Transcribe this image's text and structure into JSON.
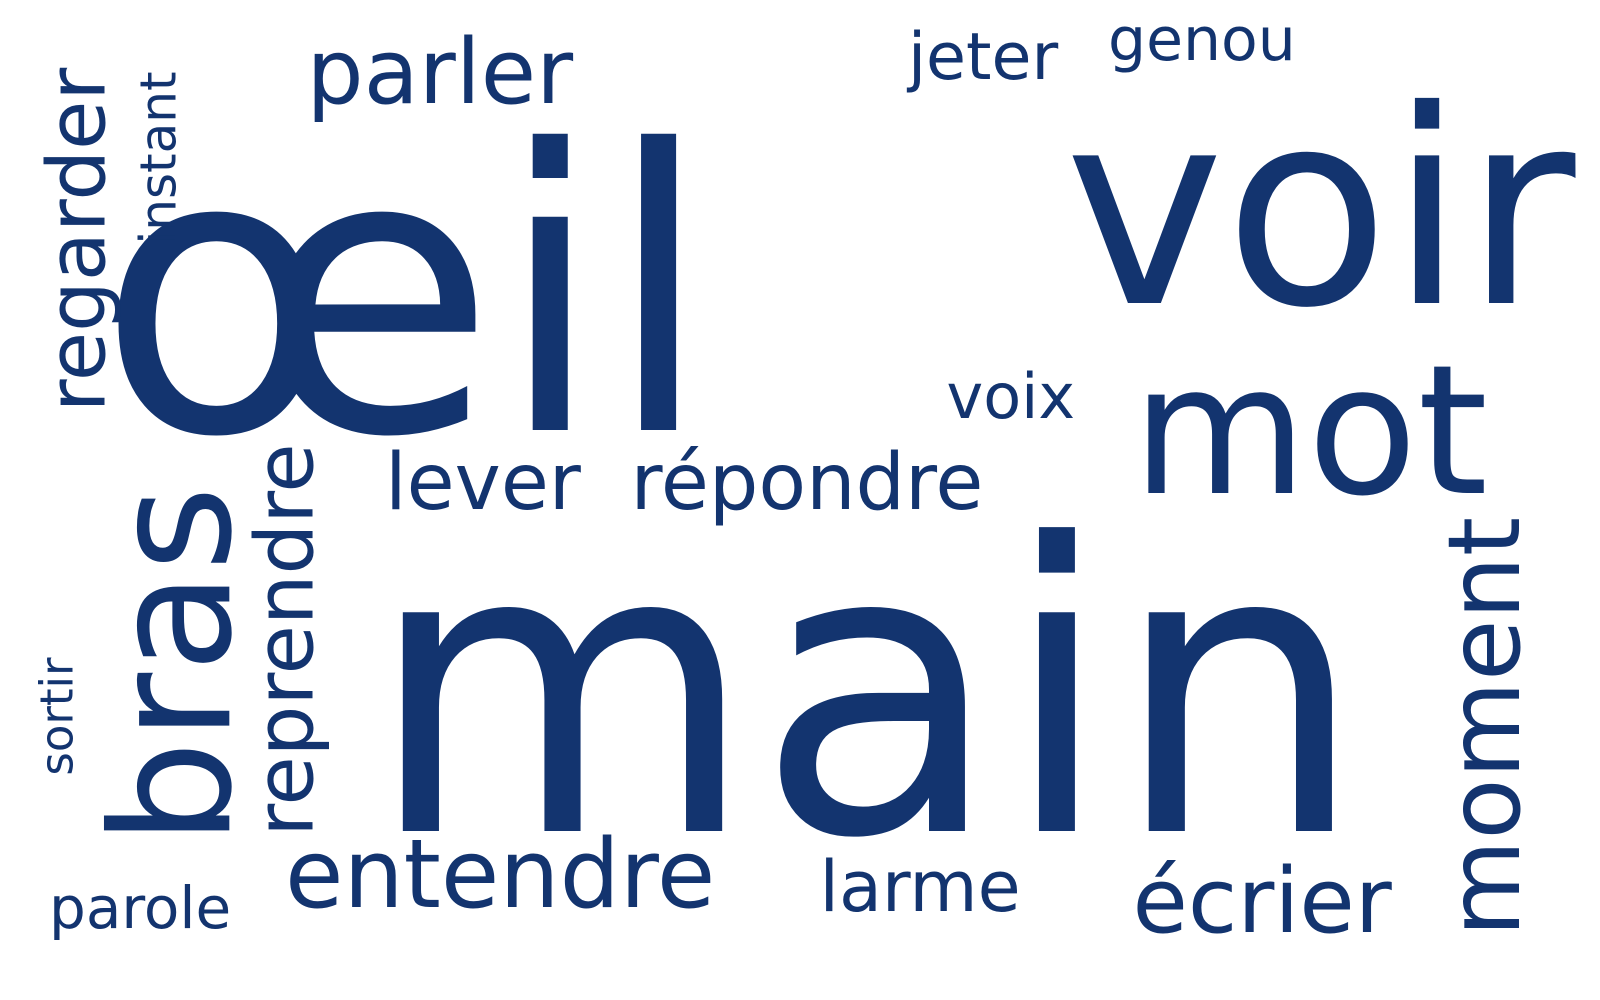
{
  "palette": {
    "text": "#13346f",
    "background": "#ffffff"
  },
  "words": [
    {
      "id": "oeil",
      "text": "œil",
      "orientation": "horizontal"
    },
    {
      "id": "main",
      "text": "main",
      "orientation": "horizontal"
    },
    {
      "id": "voir",
      "text": "voir",
      "orientation": "horizontal"
    },
    {
      "id": "mot",
      "text": "mot",
      "orientation": "horizontal"
    },
    {
      "id": "bras",
      "text": "bras",
      "orientation": "vertical"
    },
    {
      "id": "parler",
      "text": "parler",
      "orientation": "horizontal"
    },
    {
      "id": "regarder",
      "text": "regarder",
      "orientation": "vertical"
    },
    {
      "id": "moment",
      "text": "moment",
      "orientation": "vertical"
    },
    {
      "id": "entendre",
      "text": "entendre",
      "orientation": "horizontal"
    },
    {
      "id": "reprendre",
      "text": "reprendre",
      "orientation": "vertical"
    },
    {
      "id": "lever",
      "text": "lever",
      "orientation": "horizontal"
    },
    {
      "id": "repondre",
      "text": "répondre",
      "orientation": "horizontal"
    },
    {
      "id": "ecrier",
      "text": "écrier",
      "orientation": "horizontal"
    },
    {
      "id": "jeter",
      "text": "jeter",
      "orientation": "horizontal"
    },
    {
      "id": "genou",
      "text": "genou",
      "orientation": "horizontal"
    },
    {
      "id": "instant",
      "text": "instant",
      "orientation": "vertical"
    },
    {
      "id": "voix",
      "text": "voix",
      "orientation": "horizontal"
    },
    {
      "id": "larme",
      "text": "larme",
      "orientation": "horizontal"
    },
    {
      "id": "sortir",
      "text": "sortir",
      "orientation": "vertical"
    },
    {
      "id": "parole",
      "text": "parole",
      "orientation": "horizontal"
    }
  ]
}
